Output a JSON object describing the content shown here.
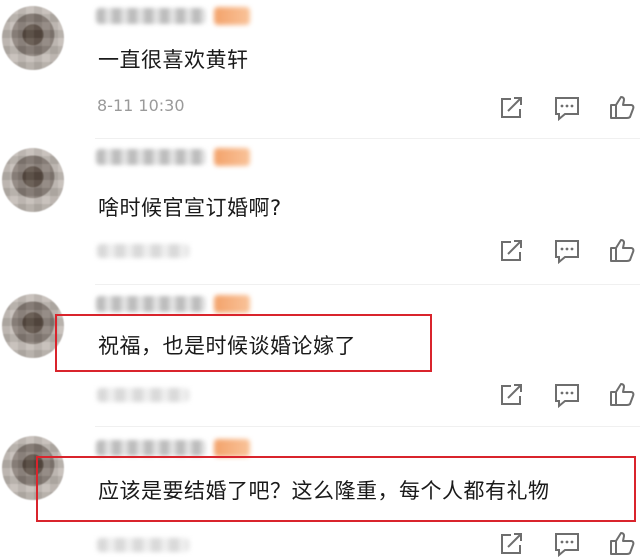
{
  "comments": [
    {
      "text": "一直很喜欢黄轩",
      "time": "8-11 10:30",
      "highlighted": false
    },
    {
      "text": "啥时候官宣订婚啊?",
      "time": "",
      "highlighted": false
    },
    {
      "text": "祝福，也是时候谈婚论嫁了",
      "time": "",
      "highlighted": true
    },
    {
      "text": "应该是要结婚了吧？这么隆重，每个人都有礼物",
      "time": "",
      "highlighted": true
    }
  ],
  "actions": [
    "share-icon",
    "comment-icon",
    "like-icon"
  ],
  "colors": {
    "highlight": "#d9242c",
    "meta": "#9a9a9a",
    "text": "#1a1a1a",
    "icon": "#6e6e6e"
  }
}
